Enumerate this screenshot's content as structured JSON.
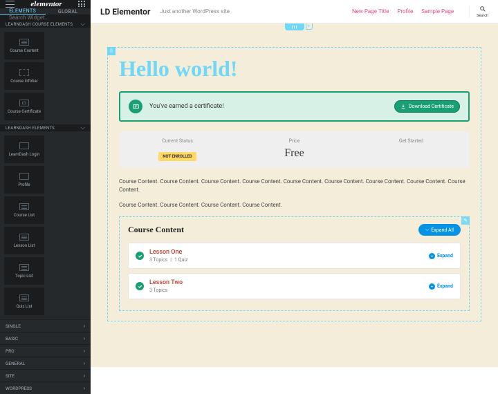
{
  "sidebar": {
    "logo": "elementor",
    "tabs": {
      "elements": "ELEMENTS",
      "global": "GLOBAL"
    },
    "search_placeholder": "Search Widget...",
    "cat1": "LEARNDASH COURSE ELEMENTS",
    "widgets1": [
      "Course Content",
      "Course Infobar",
      "Course Certificate"
    ],
    "cat2": "LEARNDASH ELEMENTS",
    "widgets2": [
      "LearnDash Login",
      "Profile",
      "Course List",
      "Lesson List",
      "Topic List",
      "Quiz List"
    ],
    "cats": [
      "SINGLE",
      "BASIC",
      "PRO",
      "GENERAL",
      "SITE",
      "WORDPRESS"
    ]
  },
  "topbar": {
    "brand": "LD Elementor",
    "tagline": "Just another WordPress site",
    "nav": [
      "New Page Title",
      "Profile",
      "Sample Page"
    ],
    "search": "Search"
  },
  "page": {
    "title": "Hello world!",
    "cert_msg": "You've earned a certificate!",
    "cert_btn": "Download Certificate",
    "info": {
      "status_lbl": "Current Status",
      "status_val": "NOT ENROLLED",
      "price_lbl": "Price",
      "price_val": "Free",
      "start_lbl": "Get Started"
    },
    "desc1": "Course Content. Course Content. Course Content. Course Content. Course Content. Course Content. Course Content. Course Content. Course Content.",
    "desc2": "Course Content. Course Content. Course Content. Course Content.",
    "cc_title": "Course Content",
    "expand_all": "Expand All",
    "expand": "Expand",
    "lessons": [
      {
        "name": "Lesson One",
        "meta_a": "3 Topics",
        "meta_b": "1 Quiz"
      },
      {
        "name": "Lesson Two",
        "meta_a": "3 Topics",
        "meta_b": ""
      }
    ]
  }
}
